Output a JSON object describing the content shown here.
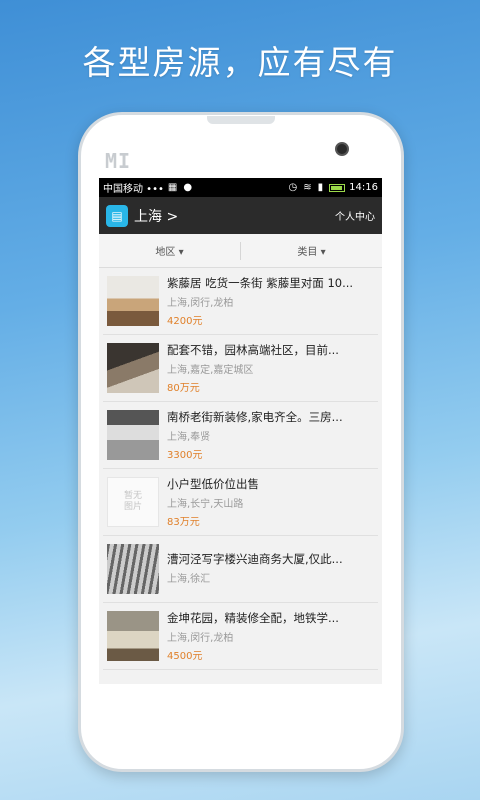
{
  "headline": "各型房源，应有尽有",
  "device": {
    "brand": "MI"
  },
  "status_bar": {
    "carrier": "中国移动 •••",
    "time": "14:16"
  },
  "app_bar": {
    "city": "上海 >",
    "profile": "个人中心"
  },
  "filters": [
    {
      "label": "地区 ▾"
    },
    {
      "label": "类目 ▾"
    }
  ],
  "placeholder_text": "暂无\n图片",
  "listings": [
    {
      "title": "紫藤居 吃货一条街 紫藤里对面 10...",
      "location": "上海,闵行,龙柏",
      "price": "4200元"
    },
    {
      "title": "配套不错，园林高端社区，目前...",
      "location": "上海,嘉定,嘉定城区",
      "price": "80万元"
    },
    {
      "title": "南桥老街新装修,家电齐全。三房...",
      "location": "上海,奉贤",
      "price": "3300元"
    },
    {
      "title": "小户型低价位出售",
      "location": "上海,长宁,天山路",
      "price": "83万元"
    },
    {
      "title": "漕河泾写字楼兴迪商务大厦,仅此...",
      "location": "上海,徐汇",
      "price": ""
    },
    {
      "title": "金坤花园，精装修全配，地铁学...",
      "location": "上海,闵行,龙柏",
      "price": "4500元"
    }
  ]
}
